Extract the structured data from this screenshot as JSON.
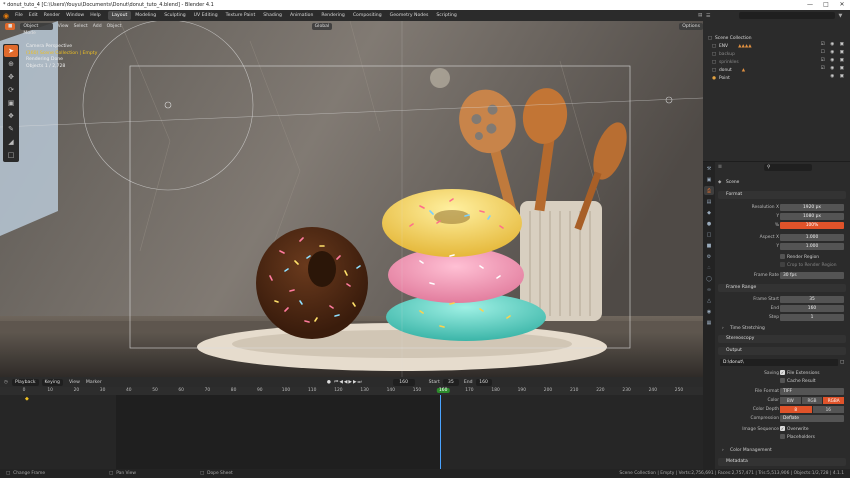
{
  "window": {
    "title": "* donut_tuto_4 [C:\\Users\\Youyu\\Documents\\Donut\\donut_tuto_4.blend] - Blender 4.1"
  },
  "topbar": {
    "menus": [
      "File",
      "Edit",
      "Render",
      "Window",
      "Help"
    ],
    "workspaces": [
      "Layout",
      "Modeling",
      "Sculpting",
      "UV Editing",
      "Texture Paint",
      "Shading",
      "Animation",
      "Rendering",
      "Compositing",
      "Geometry Nodes",
      "Scripting"
    ],
    "active_workspace": "Layout",
    "scene": "Scene",
    "view_layer": "ViewLayer"
  },
  "viewport": {
    "mode": "Object Mode",
    "menus": [
      "View",
      "Select",
      "Add",
      "Object"
    ],
    "transform": "Global",
    "options": "Options",
    "overlay_lines": [
      "Camera Perspective",
      "(160) Scene Collection | Empty",
      "Rendering Done",
      "Objects    1 / 2,728"
    ]
  },
  "outliner": {
    "search_placeholder": "",
    "root": "Scene Collection",
    "items": [
      {
        "name": "ENV",
        "dim": false
      },
      {
        "name": "backup",
        "dim": true
      },
      {
        "name": "sprinkles",
        "dim": true
      },
      {
        "name": "donut",
        "dim": false
      },
      {
        "name": "Point",
        "dim": false
      }
    ]
  },
  "properties": {
    "scene_label": "Scene",
    "format": {
      "title": "Format",
      "resolution_x_label": "Resolution X",
      "resolution_x": "1920 px",
      "y_label": "Y",
      "resolution_y": "1080 px",
      "pct_label": "%",
      "percent": "100%",
      "aspect_x_label": "Aspect X",
      "aspect_x": "1.000",
      "aspect_y_label": "Y",
      "aspect_y": "1.000",
      "render_region": "Render Region",
      "crop": "Crop to Render Region",
      "frame_rate_label": "Frame Rate",
      "frame_rate": "30 fps"
    },
    "frame_range": {
      "title": "Frame Range",
      "start_label": "Frame Start",
      "start": "35",
      "end_label": "End",
      "end": "160",
      "step_label": "Step",
      "step": "1"
    },
    "time_stretching": "Time Stretching",
    "stereoscopy": "Stereoscopy",
    "output": {
      "title": "Output",
      "path": "D:\\donut\\",
      "saving_label": "Saving",
      "file_extensions": "File Extensions",
      "cache_result": "Cache Result",
      "file_format_label": "File Format",
      "file_format": "TIFF",
      "color_label": "Color",
      "color_options": [
        "BW",
        "RGB",
        "RGBA"
      ],
      "color_active": "RGBA",
      "color_depth_label": "Color Depth",
      "depth_options": [
        "8",
        "16"
      ],
      "depth_active": "8",
      "compression_label": "Compression",
      "compression": "Deflate",
      "image_sequence_label": "Image Sequence",
      "overwrite": "Overwrite",
      "placeholders": "Placeholders"
    },
    "color_management": "Color Management",
    "metadata": "Metadata"
  },
  "timeline": {
    "menus": [
      "Playback",
      "Keying",
      "View",
      "Marker"
    ],
    "current_frame": "160",
    "start_label": "Start",
    "start": "35",
    "end_label": "End",
    "end": "160",
    "ruler": [
      "0",
      "10",
      "20",
      "30",
      "40",
      "50",
      "60",
      "70",
      "80",
      "90",
      "100",
      "110",
      "120",
      "130",
      "140",
      "150",
      "160",
      "170",
      "180",
      "190",
      "200",
      "210",
      "220",
      "230",
      "240",
      "250"
    ]
  },
  "statusbar": {
    "left": [
      "Change Frame",
      "Pan View",
      "Dope Sheet"
    ],
    "right": "Scene Collection | Empty | Verts:2,756,691 | Faces:2,757,471 | Tris:5,513,906 | Objects:1/2,728 | 4.1.1"
  },
  "colors": {
    "accent": "#e06a2c",
    "selected": "#e0532a"
  }
}
